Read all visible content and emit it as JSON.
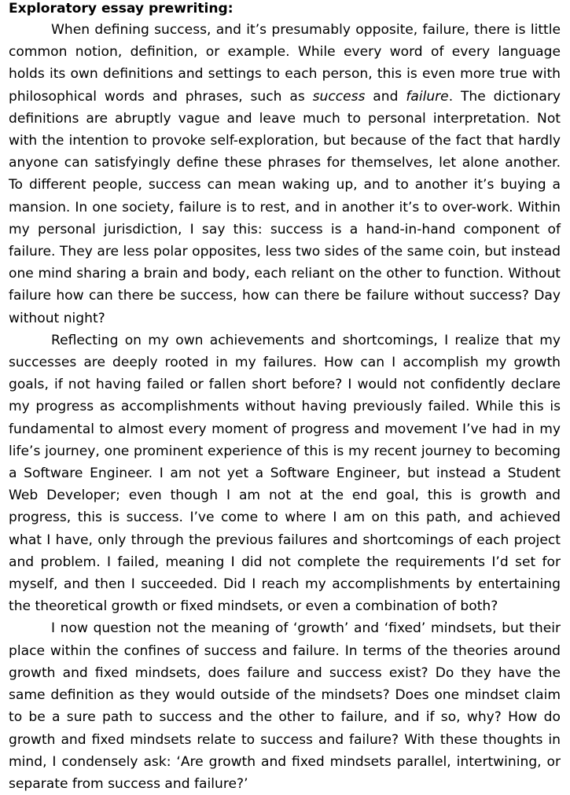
{
  "document": {
    "title": "Exploratory essay prewriting:",
    "paragraph1": {
      "before_success": "When defining success, and it’s presumably opposite, failure, there is little common notion, definition, or example. While every word of every language holds its own definitions and settings to each person, this is even more true with philosophical words and phrases, such as ",
      "success_word": "success",
      "and_word": " and ",
      "failure_word": "failure",
      "after_failure": ". The dictionary definitions are abruptly vague and leave much to personal interpretation. Not with the intention to provoke self-exploration, but because of the fact that hardly anyone can satisfyingly define these phrases for themselves, let alone another. To different people, success can mean waking up, and to another it’s buying a mansion. In one society, failure is to rest, and in another it’s to over-work. Within my personal jurisdiction, I say this: success is a hand-in-hand component of failure. They are less polar opposites, less two sides of the same coin, but instead one mind sharing a brain and body, each reliant on the other to function. Without failure how can there be success, how can there be failure without success? Day without night?"
    },
    "paragraph2": "Reflecting on my own achievements and shortcomings, I realize that my successes are deeply rooted in my failures. How can I accomplish my growth goals, if not having failed or fallen short before? I would not confidently declare my progress as accomplishments without having previously failed. While this is fundamental to almost every moment of progress and movement I’ve had in my life’s journey, one prominent experience of this is my recent journey to becoming a Software Engineer. I am not yet a Software Engineer, but instead a Student Web Developer; even though I am not at the end goal, this is growth and progress, this is success. I’ve come to where I am on this path, and achieved what I have, only through the previous failures and shortcomings of each project and problem. I failed, meaning I did not complete the requirements I’d set for myself, and then I succeeded. Did I reach my accomplishments by entertaining the theoretical growth or fixed mindsets, or even a combination of both?",
    "paragraph3": "I now question not the meaning of ‘growth’ and ‘fixed’ mindsets, but their place within the confines of success and failure.  In terms of the theories around growth and fixed mindsets, does failure and success exist? Do they have the same definition as they would outside of the mindsets? Does one mindset claim to be a sure path to success and the other to failure, and if so, why? How do growth and fixed mindsets relate to success and failure? With these thoughts in mind, I condensely ask: ‘Are growth and fixed mindsets parallel, intertwining, or separate from success and failure?’"
  }
}
